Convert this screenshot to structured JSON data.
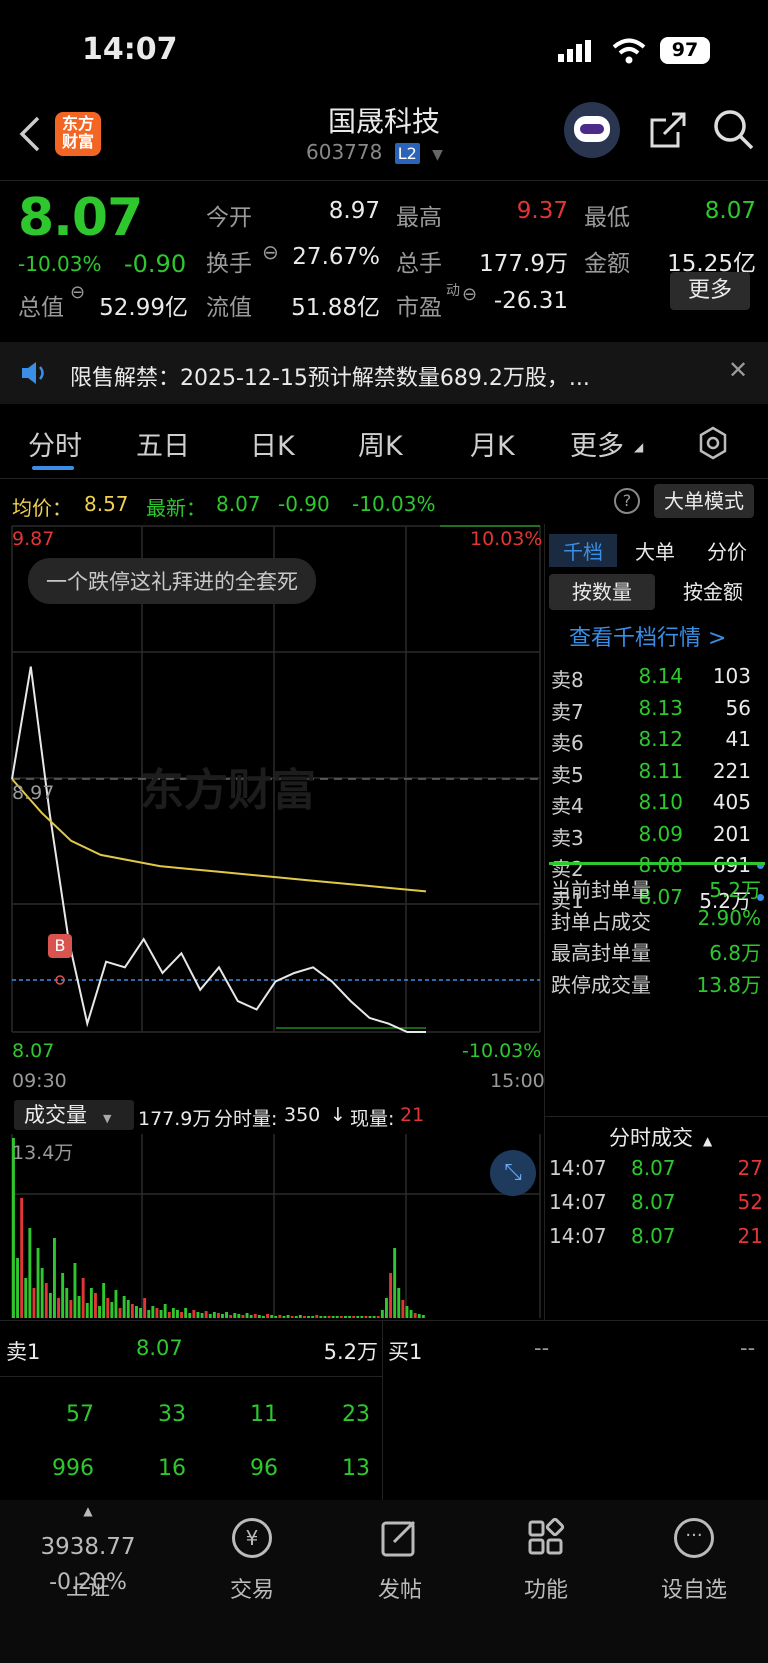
{
  "status": {
    "time": "14:07",
    "battery": "97"
  },
  "header": {
    "title": "国晟科技",
    "code": "603778",
    "level": "L2",
    "logo": "东方财富"
  },
  "quote": {
    "price": "8.07",
    "pct": "-10.03%",
    "chg": "-0.90",
    "rows": [
      [
        {
          "k": "今开",
          "v": "8.97",
          "c": "w"
        },
        {
          "k": "最高",
          "v": "9.37",
          "c": "r"
        },
        {
          "k": "最低",
          "v": "8.07",
          "c": "g"
        }
      ],
      [
        {
          "k": "换手",
          "v": "27.67%",
          "c": "w"
        },
        {
          "k": "总手",
          "v": "177.9万",
          "c": "w"
        },
        {
          "k": "金额",
          "v": "15.25亿",
          "c": "w"
        }
      ],
      [
        {
          "k": "总值",
          "v": "52.99亿",
          "c": "w"
        },
        {
          "k": "流值",
          "v": "51.88亿",
          "c": "w"
        },
        {
          "k": "市盈",
          "v": "-26.31",
          "c": "w"
        }
      ]
    ],
    "pe_sup": "动",
    "more": "更多"
  },
  "notice": {
    "text": "限售解禁：2025-12-15预计解禁数量689.2万股，..."
  },
  "tabs": [
    "分时",
    "五日",
    "日K",
    "周K",
    "月K",
    "更多"
  ],
  "avg_bar": {
    "avg_label": "均价：",
    "avg": "8.57",
    "latest_label": "最新：",
    "latest": "8.07",
    "chg": "-0.90",
    "pct": "-10.03%",
    "mode": "大单模式"
  },
  "chart": {
    "high": "9.87",
    "high_pct": "10.03%",
    "low": "8.07",
    "low_pct": "-10.03%",
    "mid": "8.97",
    "t0": "09:30",
    "t1": "15:00",
    "toast": "一个跌停这礼拜进的全套死",
    "watermark": "东方财富",
    "b_mark": "B"
  },
  "chart_data": {
    "type": "line",
    "xlabel": "",
    "ylabel": "",
    "ylim": [
      8.07,
      9.87
    ],
    "x": [
      "09:30",
      "15:00"
    ],
    "series": [
      {
        "values": [
          8.97,
          9.37,
          8.85,
          8.4,
          8.1,
          8.32,
          8.3,
          8.4,
          8.28,
          8.35,
          8.22,
          8.3,
          8.18,
          8.15,
          8.25,
          8.28,
          8.3,
          8.25,
          8.18,
          8.12,
          8.1,
          8.07,
          8.07
        ]
      },
      {
        "values": [
          8.97,
          8.85,
          8.75,
          8.7,
          8.68,
          8.66,
          8.65,
          8.64,
          8.63,
          8.62,
          8.61,
          8.6,
          8.59,
          8.58,
          8.57
        ]
      }
    ]
  },
  "vol_bar": {
    "label": "成交量",
    "total": "177.9万",
    "fen_label": "分时量:",
    "fen": "350",
    "xian_label": "现量:",
    "xian": "21",
    "max": "13.4万"
  },
  "ob_tabs": [
    "千档",
    "大单",
    "分价"
  ],
  "ob_sub": [
    "按数量",
    "按金额"
  ],
  "ob_link": "查看千档行情 >",
  "asks": [
    {
      "l": "卖8",
      "p": "8.14",
      "v": "103"
    },
    {
      "l": "卖7",
      "p": "8.13",
      "v": "56"
    },
    {
      "l": "卖6",
      "p": "8.12",
      "v": "41"
    },
    {
      "l": "卖5",
      "p": "8.11",
      "v": "221"
    },
    {
      "l": "卖4",
      "p": "8.10",
      "v": "405"
    },
    {
      "l": "卖3",
      "p": "8.09",
      "v": "201"
    },
    {
      "l": "卖2",
      "p": "8.08",
      "v": "691"
    },
    {
      "l": "卖1",
      "p": "8.07",
      "v": "5.2万"
    }
  ],
  "seal": [
    {
      "k": "当前封单量",
      "v": "5.2万"
    },
    {
      "k": "封单占成交",
      "v": "2.90%"
    },
    {
      "k": "最高封单量",
      "v": "6.8万"
    },
    {
      "k": "跌停成交量",
      "v": "13.8万"
    }
  ],
  "ticks_title": "分时成交",
  "ticks": [
    {
      "t": "14:07",
      "p": "8.07",
      "v": "27"
    },
    {
      "t": "14:07",
      "p": "8.07",
      "v": "52"
    },
    {
      "t": "14:07",
      "p": "8.07",
      "v": "21"
    }
  ],
  "l1": {
    "sell": "卖1",
    "sell_p": "8.07",
    "sell_v": "5.2万",
    "buy": "买1",
    "buy_p": "--",
    "buy_v": "--"
  },
  "queue": [
    [
      "57",
      "33",
      "11",
      "23"
    ],
    [
      "996",
      "16",
      "96",
      "13"
    ]
  ],
  "nav": {
    "index": "3938.77",
    "index_name": "上证",
    "index_pct": "-0.20%",
    "items": [
      "交易",
      "发帖",
      "功能",
      "设自选"
    ]
  }
}
